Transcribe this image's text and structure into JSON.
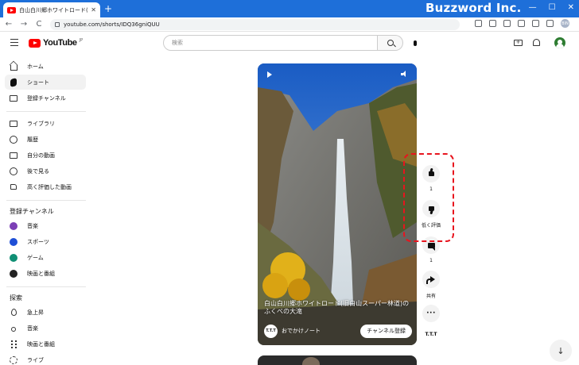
{
  "browser": {
    "tab_title": "白山白川郷ホワイトロード(旧 白山スーパー林道)",
    "tab_close": "✕",
    "new_tab": "+",
    "url": "youtube.com/shorts/IDQ36gniQUU",
    "back": "←",
    "forward": "→",
    "reload": "C",
    "profile_initials": "BIN",
    "menu": "⋮",
    "window_controls": [
      "—",
      "☐",
      "✕"
    ]
  },
  "watermark": "Buzzword Inc.",
  "masthead": {
    "logo_text": "YouTube",
    "logo_sup": "JP",
    "search_placeholder": "検索"
  },
  "sidebar": {
    "primary": [
      {
        "label": "ホーム",
        "icon": "home-icon"
      },
      {
        "label": "ショート",
        "icon": "shorts-icon",
        "active": true
      },
      {
        "label": "登録チャンネル",
        "icon": "subscriptions-icon"
      }
    ],
    "library": [
      {
        "label": "ライブラリ",
        "icon": "library-icon"
      },
      {
        "label": "履歴",
        "icon": "history-icon"
      },
      {
        "label": "自分の動画",
        "icon": "your-videos-icon"
      },
      {
        "label": "後で見る",
        "icon": "watch-later-icon"
      },
      {
        "label": "高く評価した動画",
        "icon": "liked-videos-icon"
      }
    ],
    "subscriptions_title": "登録チャンネル",
    "subscriptions": [
      {
        "label": "音楽",
        "color": "#7b3fb5"
      },
      {
        "label": "スポーツ",
        "color": "#1e4fd6"
      },
      {
        "label": "ゲーム",
        "color": "#0f8f74"
      },
      {
        "label": "映画と番組",
        "color": "#222222"
      }
    ],
    "explore_title": "探索",
    "explore": [
      {
        "label": "急上昇",
        "icon": "trending-icon"
      },
      {
        "label": "音楽",
        "icon": "music-icon"
      },
      {
        "label": "映画と番組",
        "icon": "movies-icon"
      },
      {
        "label": "ライブ",
        "icon": "live-icon"
      }
    ]
  },
  "short": {
    "title": "白山白川郷ホワイトロード(旧白山スーパー林道)のふくべの大滝",
    "channel_avatar": "T.T.T",
    "channel_name": "おでかけノート",
    "subscribe_label": "チャンネル登録"
  },
  "actions": {
    "like_count": "1",
    "dislike_label": "低く評価",
    "comment_count": "1",
    "share_label": "共有",
    "more_label": "···",
    "channel_label": "T.T.T"
  },
  "scroll_down": "↓",
  "colors": {
    "chrome_blue": "#1e6fd9",
    "youtube_red": "#ff0000",
    "highlight_red": "#e8141e"
  }
}
